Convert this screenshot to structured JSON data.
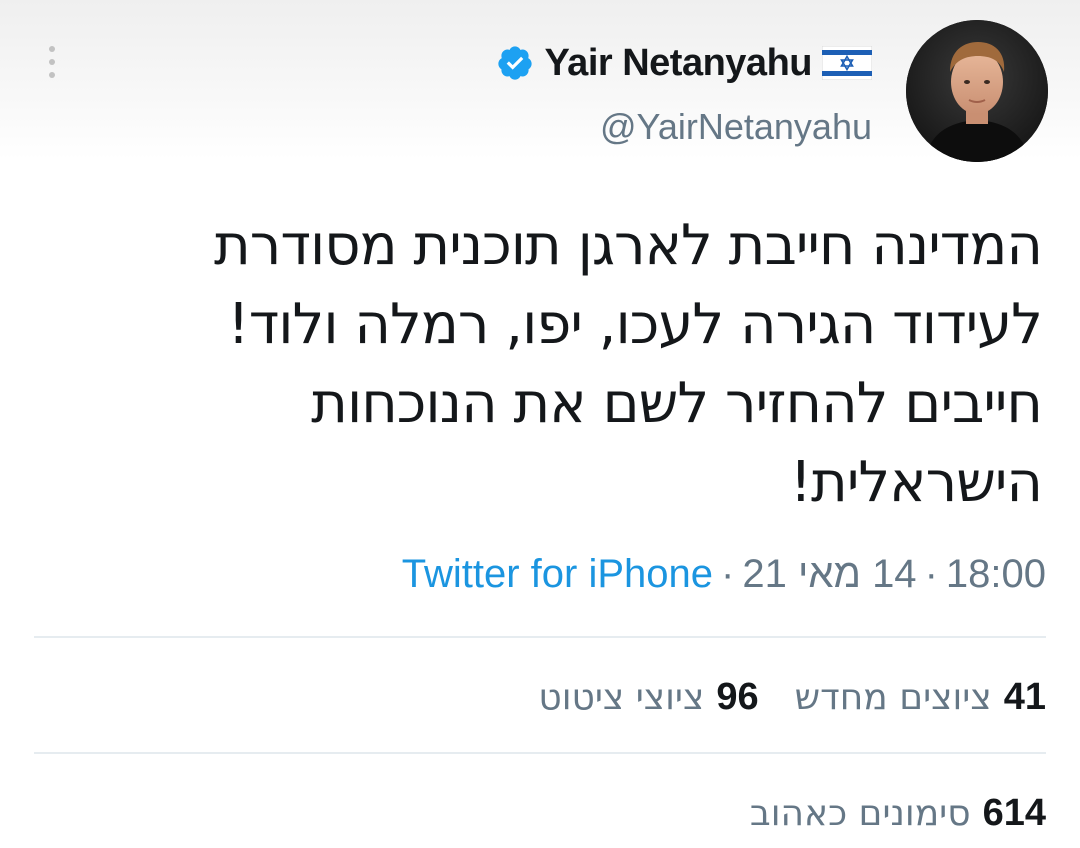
{
  "header": {
    "display_name": "Yair Netanyahu",
    "handle": "@YairNetanyahu",
    "verified": true,
    "flag": "israel-flag-icon",
    "accent_color": "#1da1f2"
  },
  "tweet": {
    "lines": [
      "המדינה חייבת לארגן תוכנית מסודרת",
      "לעידוד הגירה לעכו, יפו, רמלה ולוד!",
      "חייבים להחזיר לשם את הנוכחות",
      "הישראלית!"
    ]
  },
  "meta": {
    "time": "18:00",
    "date": "14 מאי 21",
    "source": "Twitter for iPhone",
    "separator": "·",
    "source_color": "#1b95e0"
  },
  "stats": {
    "retweets_count": "41",
    "retweets_label": "ציוצים מחדש",
    "quotes_count": "96",
    "quotes_label": "ציוצי ציטוט",
    "likes_count": "614",
    "likes_label": "סימונים כאהוב"
  }
}
